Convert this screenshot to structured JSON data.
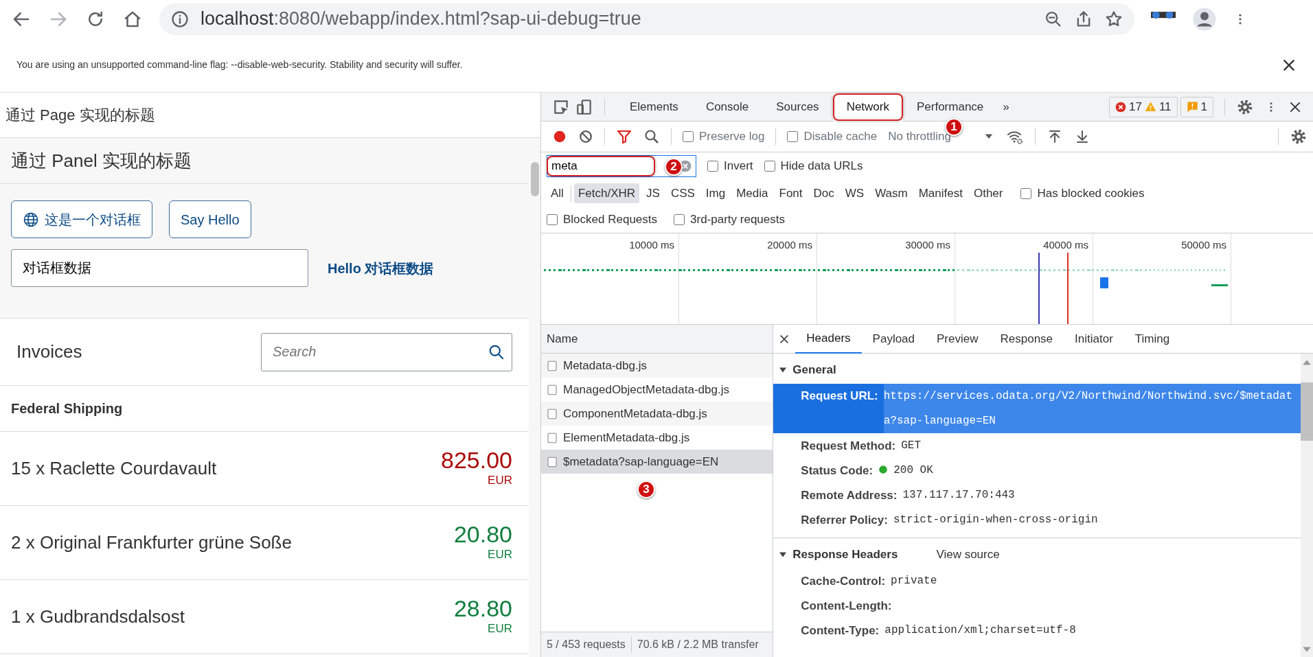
{
  "browser": {
    "url_host": "localhost",
    "url_path": ":8080/webapp/index.html?sap-ui-debug=true"
  },
  "infobar": {
    "message": "You are using an unsupported command-line flag: --disable-web-security. Stability and security will suffer."
  },
  "app": {
    "page_title": "通过 Page 实现的标题",
    "panel_title": "通过 Panel 实现的标题",
    "buttons": [
      {
        "label": "这是一个对话框",
        "kind": "icon"
      },
      {
        "label": "Say Hello",
        "kind": "text"
      }
    ],
    "input": {
      "value": "对话框数据"
    },
    "greeting": "Hello 对话框数据",
    "list": {
      "title": "Invoices",
      "search_placeholder": "Search",
      "group": "Federal Shipping",
      "items": [
        {
          "name": "15 x Raclette Courdavault",
          "price": "825.00",
          "currency": "EUR",
          "color": "#aa0808"
        },
        {
          "name": "2 x Original Frankfurter grüne Soße",
          "price": "20.80",
          "currency": "EUR",
          "color": "#107e3e"
        },
        {
          "name": "1 x Gudbrandsdalsost",
          "price": "28.80",
          "currency": "EUR",
          "color": "#107e3e"
        }
      ]
    }
  },
  "devtools": {
    "tabs": [
      {
        "label": "Elements",
        "selected": false
      },
      {
        "label": "Console",
        "selected": false
      },
      {
        "label": "Sources",
        "selected": false
      },
      {
        "label": "Network",
        "selected": true
      },
      {
        "label": "Performance",
        "selected": false
      }
    ],
    "more": "»",
    "counts": {
      "errors": "17",
      "warnings": "11",
      "issues": "1"
    },
    "toolbar": {
      "recording": true,
      "filter_active": true,
      "preserve_log": {
        "label": "Preserve log",
        "checked": false
      },
      "disable_cache": {
        "label": "Disable cache",
        "checked": false
      },
      "throttling": "No throttling"
    },
    "filter": {
      "value": "meta",
      "invert": {
        "label": "Invert",
        "checked": false
      },
      "hide_data_urls": {
        "label": "Hide data URLs",
        "checked": false
      }
    },
    "types": [
      {
        "label": "All",
        "selected": false
      },
      {
        "label": "Fetch/XHR",
        "selected": true
      },
      {
        "label": "JS",
        "selected": false
      },
      {
        "label": "CSS",
        "selected": false
      },
      {
        "label": "Img",
        "selected": false
      },
      {
        "label": "Media",
        "selected": false
      },
      {
        "label": "Font",
        "selected": false
      },
      {
        "label": "Doc",
        "selected": false
      },
      {
        "label": "WS",
        "selected": false
      },
      {
        "label": "Wasm",
        "selected": false
      },
      {
        "label": "Manifest",
        "selected": false
      },
      {
        "label": "Other",
        "selected": false
      }
    ],
    "has_blocked_cookies": {
      "label": "Has blocked cookies",
      "checked": false
    },
    "blocked_requests": {
      "label": "Blocked Requests",
      "checked": false
    },
    "third_party": {
      "label": "3rd-party requests",
      "checked": false
    },
    "timeline": {
      "ticks": [
        "10000 ms",
        "20000 ms",
        "30000 ms",
        "40000 ms",
        "50000 ms"
      ]
    },
    "requests": {
      "column": "Name",
      "rows": [
        {
          "name": "Metadata-dbg.js",
          "selected": false
        },
        {
          "name": "ManagedObjectMetadata-dbg.js",
          "selected": false
        },
        {
          "name": "ComponentMetadata-dbg.js",
          "selected": false
        },
        {
          "name": "ElementMetadata-dbg.js",
          "selected": false
        },
        {
          "name": "$metadata?sap-language=EN",
          "selected": true
        }
      ],
      "summary": "5 / 453 requests",
      "transfer": "70.6 kB / 2.2 MB transfer"
    },
    "details": {
      "tabs": [
        {
          "label": "Headers",
          "selected": true
        },
        {
          "label": "Payload",
          "selected": false
        },
        {
          "label": "Preview",
          "selected": false
        },
        {
          "label": "Response",
          "selected": false
        },
        {
          "label": "Initiator",
          "selected": false
        },
        {
          "label": "Timing",
          "selected": false
        }
      ],
      "sections": [
        {
          "title": "General",
          "expanded": true,
          "rows": [
            {
              "label": "Request URL:",
              "value": "https://services.odata.org/V2/Northwind/Northwind.svc/$metadata?sap-language=EN",
              "kind": "plain",
              "selected": true
            },
            {
              "label": "Request Method:",
              "value": "GET",
              "kind": "plain",
              "selected": false
            },
            {
              "label": "Status Code:",
              "value": "200 OK",
              "kind": "status",
              "selected": false
            },
            {
              "label": "Remote Address:",
              "value": "137.117.17.70:443",
              "kind": "plain",
              "selected": false
            },
            {
              "label": "Referrer Policy:",
              "value": "strict-origin-when-cross-origin",
              "kind": "plain",
              "selected": false
            }
          ]
        },
        {
          "title": "Response Headers",
          "expanded": true,
          "link": "View source",
          "rows": [
            {
              "label": "Cache-Control:",
              "value": "private",
              "kind": "plain",
              "selected": false
            },
            {
              "label": "Content-Length:",
              "kind": "plain",
              "selected": false
            },
            {
              "label": "Content-Type:",
              "value": "application/xml;charset=utf-8",
              "kind": "plain",
              "selected": false
            }
          ]
        }
      ]
    }
  },
  "callouts": [
    {
      "number": "1"
    },
    {
      "number": "2"
    },
    {
      "number": "3"
    }
  ]
}
